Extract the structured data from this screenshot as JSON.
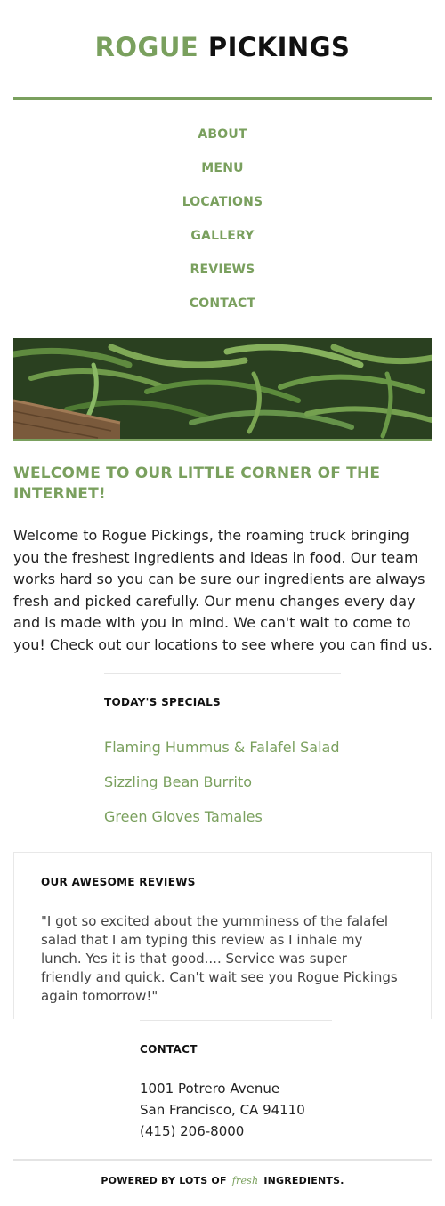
{
  "header": {
    "title_word1": "ROGUE",
    "title_word2": "PICKINGS"
  },
  "nav": {
    "items": [
      {
        "label": "ABOUT"
      },
      {
        "label": "MENU"
      },
      {
        "label": "LOCATIONS"
      },
      {
        "label": "GALLERY"
      },
      {
        "label": "REVIEWS"
      },
      {
        "label": "CONTACT"
      }
    ]
  },
  "hero": {
    "icon": "green-beans-photo"
  },
  "welcome": {
    "title": "WELCOME TO OUR LITTLE CORNER OF THE INTERNET!",
    "body": "Welcome to Rogue Pickings, the roaming truck bringing you the freshest ingredients and ideas in food. Our team works hard so you can be sure our ingredients are always fresh and picked carefully. Our menu changes every day and is made with you in mind. We can't wait to come to you! Check out our locations to see where you can find us."
  },
  "specials": {
    "title": "TODAY'S SPECIALS",
    "items": [
      {
        "label": "Flaming Hummus & Falafel Salad"
      },
      {
        "label": "Sizzling Bean Burrito"
      },
      {
        "label": "Green Gloves Tamales"
      }
    ]
  },
  "reviews": {
    "title": "OUR AWESOME REVIEWS",
    "quote": "\"I got so excited about the yumminess of the falafel salad that I am typing this review as I inhale my lunch. Yes it is that good.... Service was super friendly and quick. Can't wait see you Rogue Pickings again tomorrow!\""
  },
  "contact": {
    "title": "CONTACT",
    "address_line1": "1001 Potrero Avenue",
    "address_line2": "San Francisco, CA 94110",
    "phone": "(415) 206-8000"
  },
  "footer": {
    "prefix": "POWERED BY LOTS OF",
    "fresh": "fresh",
    "suffix": "INGREDIENTS."
  },
  "colors": {
    "accent": "#7aa05e",
    "text": "#222222"
  }
}
